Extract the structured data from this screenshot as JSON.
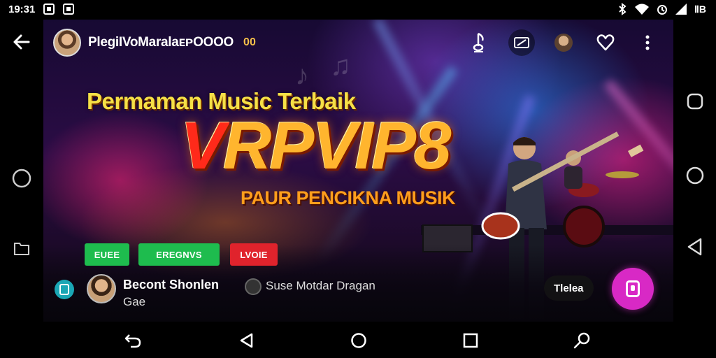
{
  "status_bar": {
    "time": "19:31",
    "battery_label": "ⅡB"
  },
  "header": {
    "channel_name": "PlegiIVoMaralaᴇᴘOOOO",
    "channel_badge": "00"
  },
  "banner": {
    "tagline": "Permaman Music Terbaik",
    "brand_v": "V",
    "brand_rest": "RPVIP8",
    "subline": "PAUR PENCIKNA MUSIK"
  },
  "tags": [
    {
      "label": "EUEE",
      "color": "#1ebc4e"
    },
    {
      "label": "EREGNVS",
      "color": "#1ebc4e"
    },
    {
      "label": "LVOIE",
      "color": "#e0232c"
    }
  ],
  "uploader": {
    "name": "Becont Shonlen",
    "subtitle": "Gae"
  },
  "song": {
    "title": "Suse Motdar Dragan"
  },
  "actions": {
    "pill_label": "Tlelea"
  },
  "colors": {
    "accent": "#d829c5",
    "info_badge": "#1aa7b5"
  },
  "icons": [
    "back-arrow-icon",
    "music-note-icon",
    "cast-icon",
    "heart-icon",
    "more-vert-icon",
    "circle-icon",
    "folder-icon",
    "rounded-square-icon",
    "triangle-back-icon",
    "undo-icon",
    "home-circle-icon",
    "recents-square-icon",
    "search-icon"
  ]
}
